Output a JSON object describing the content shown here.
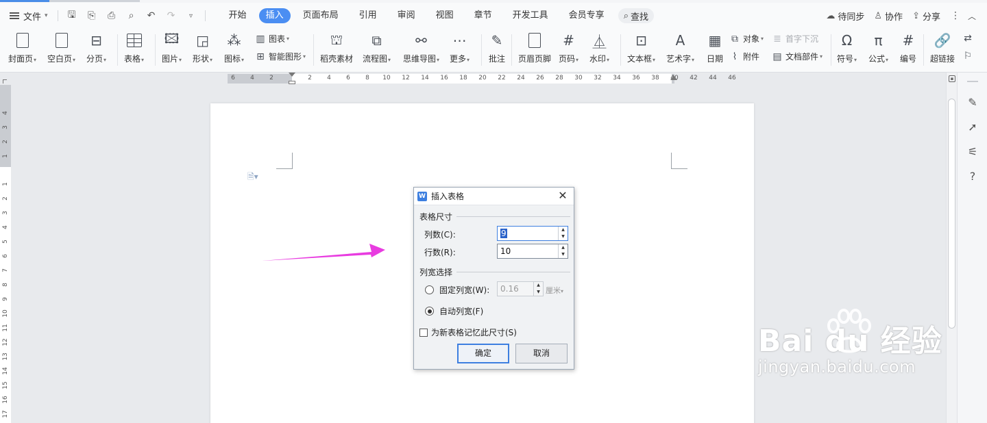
{
  "menubar": {
    "file_label": "文件",
    "tabs": [
      {
        "label": "开始"
      },
      {
        "label": "插入",
        "active": true
      },
      {
        "label": "页面布局"
      },
      {
        "label": "引用"
      },
      {
        "label": "审阅"
      },
      {
        "label": "视图"
      },
      {
        "label": "章节"
      },
      {
        "label": "开发工具"
      },
      {
        "label": "会员专享"
      }
    ],
    "search_label": "查找",
    "right": {
      "sync_label": "待同步",
      "collab_label": "协作",
      "share_label": "分享"
    }
  },
  "ribbon": {
    "cover_page": "封面页",
    "blank_page": "空白页",
    "page_break": "分页",
    "table": "表格",
    "picture": "图片",
    "shape": "形状",
    "icon": "图标",
    "chart": "图表",
    "smart_art": "智能图形",
    "docer_material": "稻壳素材",
    "flowchart": "流程图",
    "mindmap": "思维导图",
    "more": "更多",
    "comment": "批注",
    "header_footer": "页眉页脚",
    "page_number": "页码",
    "watermark": "水印",
    "textbox": "文本框",
    "wordart": "艺术字",
    "date": "日期",
    "object": "对象",
    "attachment": "附件",
    "drop_cap": "首字下沉",
    "doc_parts": "文档部件",
    "symbol": "符号",
    "formula": "公式",
    "numbering": "编号",
    "hyperlink": "超链接"
  },
  "hruler": {
    "labels": [
      "6",
      "4",
      "2",
      "2",
      "4",
      "6",
      "8",
      "10",
      "12",
      "14",
      "16",
      "18",
      "20",
      "22",
      "24",
      "26",
      "28",
      "30",
      "32",
      "34",
      "36",
      "38",
      "40",
      "42",
      "44",
      "46"
    ]
  },
  "vruler": {
    "labels": [
      "4",
      "3",
      "2",
      "1",
      "1",
      "2",
      "3",
      "4",
      "5",
      "6",
      "7",
      "8",
      "9",
      "10",
      "11",
      "12",
      "13",
      "14",
      "15",
      "16",
      "17"
    ]
  },
  "dialog": {
    "title": "插入表格",
    "size_group": "表格尺寸",
    "columns_label": "列数(C):",
    "columns_value": "9",
    "rows_label": "行数(R):",
    "rows_value": "10",
    "width_group": "列宽选择",
    "fixed_width_label": "固定列宽(W):",
    "fixed_width_value": "0.16",
    "fixed_width_unit": "厘米",
    "auto_width_label": "自动列宽(F)",
    "remember_label": "为新表格记忆此尺寸(S)",
    "ok_label": "确定",
    "cancel_label": "取消",
    "auto_width_selected": true,
    "remember_checked": false
  },
  "watermark": {
    "brand": "Bai du 经验",
    "url": "jingyan.baidu.com"
  },
  "colors": {
    "accent": "#4b8ef2",
    "arrow": "#e83ce0"
  }
}
